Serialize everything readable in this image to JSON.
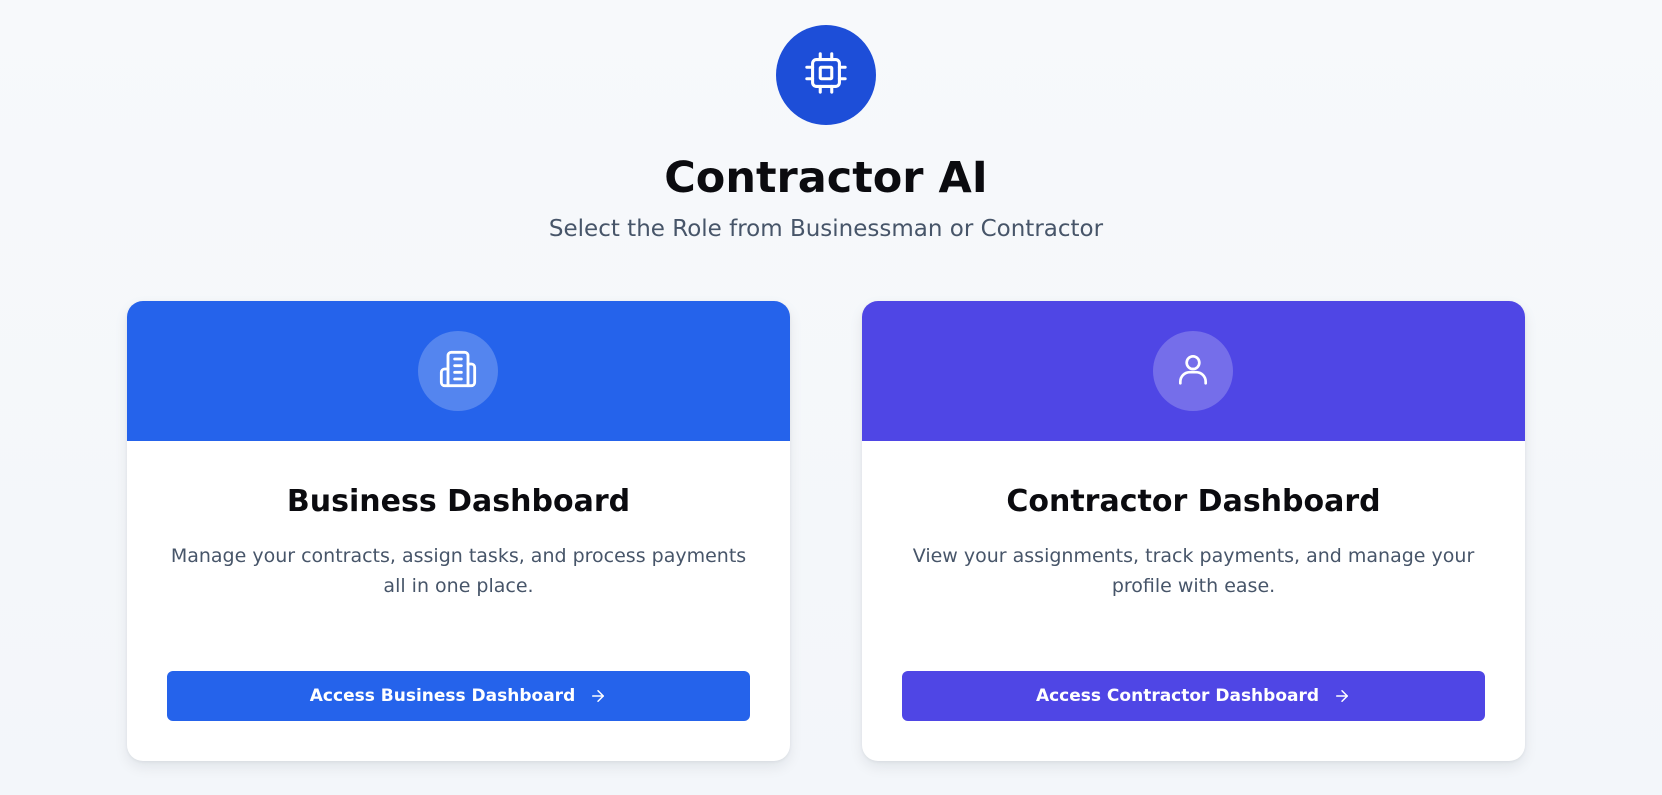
{
  "app": {
    "title": "Contractor AI",
    "subtitle": "Select the Role from Businessman or Contractor",
    "logo_icon": "cpu-chip-icon",
    "logo_color": "#1d4ed8"
  },
  "cards": [
    {
      "id": "business",
      "icon": "building-icon",
      "title": "Business Dashboard",
      "description": "Manage your contracts, assign tasks, and process payments all in one place.",
      "button_label": "Access Business Dashboard",
      "accent_color": "#2563eb"
    },
    {
      "id": "contractor",
      "icon": "user-icon",
      "title": "Contractor Dashboard",
      "description": "View your assignments, track payments, and manage your profile with ease.",
      "button_label": "Access Contractor Dashboard",
      "accent_color": "#4f46e5"
    }
  ]
}
